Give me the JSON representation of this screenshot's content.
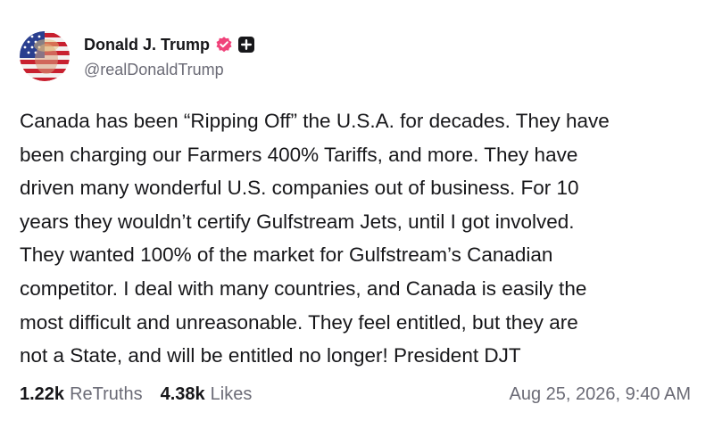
{
  "author": {
    "display_name": "Donald J. Trump",
    "handle": "@realDonaldTrump",
    "avatar_icon": "flag-portrait-avatar",
    "verified_icon": "verified-badge-icon",
    "plus_icon": "plus-square-icon"
  },
  "post": {
    "text": "Canada has been “Ripping Off” the U.S.A. for decades. They have\nbeen charging our Farmers 400% Tariffs, and more. They have\ndriven many wonderful U.S. companies out of business. For 10\nyears they wouldn’t certify Gulfstream Jets, until I got involved.\nThey wanted 100% of the market for Gulfstream’s Canadian\ncompetitor. I deal with many countries, and Canada is easily the\nmost difficult and unreasonable. They feel entitled, but they are\nnot a State, and will be entitled no longer! President DJT"
  },
  "stats": {
    "retruths_count": "1.22k",
    "retruths_label": "ReTruths",
    "likes_count": "4.38k",
    "likes_label": "Likes"
  },
  "timestamp": "Aug 25, 2026, 9:40 AM",
  "colors": {
    "badge": "#f0427a",
    "text": "#17171a",
    "muted": "#6b6b76"
  }
}
